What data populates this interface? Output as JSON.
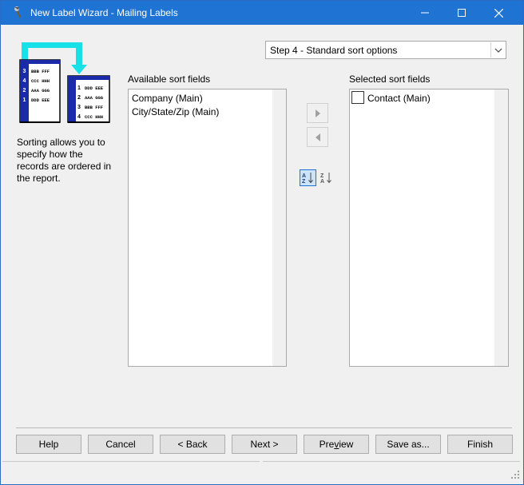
{
  "window": {
    "title": "New Label Wizard - Mailing Labels",
    "title_bar_color": "#1f73d2"
  },
  "step_select": {
    "value": "Step 4 - Standard sort options"
  },
  "illustration": {
    "stack_back": [
      {
        "num": "3",
        "text": "BBB FFF"
      },
      {
        "num": "4",
        "text": "CCC HHH"
      },
      {
        "num": "2",
        "text": "AAA GGG"
      },
      {
        "num": "1",
        "text": "DDD EEE"
      }
    ],
    "stack_front": [
      {
        "num": "1",
        "text": "DDD EEE"
      },
      {
        "num": "2",
        "text": "AAA GGG"
      },
      {
        "num": "3",
        "text": "BBB FFF"
      },
      {
        "num": "4",
        "text": "CCC HHH"
      }
    ]
  },
  "description": "Sorting allows you to specify how the records are ordered in the report.",
  "available": {
    "label": "Available sort fields",
    "items": [
      "Company (Main)",
      "City/State/Zip (Main)"
    ]
  },
  "selected": {
    "label": "Selected sort fields",
    "items": [
      "Contact (Main)"
    ]
  },
  "buttons": {
    "help": "Help",
    "cancel": "Cancel",
    "back": "< Back",
    "next": "Next >",
    "preview_pre": "Pre",
    "preview_ul": "v",
    "preview_post": "iew",
    "save_as": "Save as...",
    "finish": "Finish"
  }
}
